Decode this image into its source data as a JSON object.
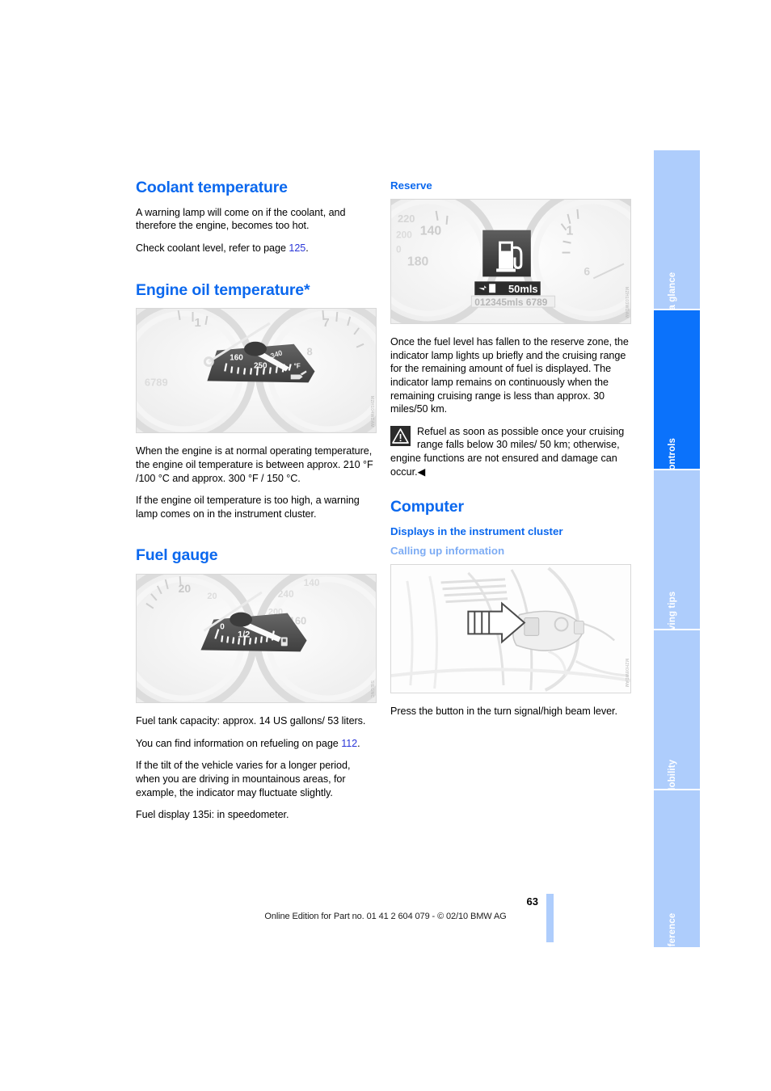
{
  "document": {
    "page_number": "63",
    "footer": "Online Edition for Part no. 01 41 2 604 079 - © 02/10 BMW AG"
  },
  "side_tabs": [
    {
      "label": "At a glance",
      "active": false
    },
    {
      "label": "Controls",
      "active": true
    },
    {
      "label": "Driving tips",
      "active": false
    },
    {
      "label": "Mobility",
      "active": false
    },
    {
      "label": "Reference",
      "active": false
    }
  ],
  "left_column": {
    "coolant": {
      "heading": "Coolant temperature",
      "p1": "A warning lamp will come on if the coolant, and therefore the engine, becomes too hot.",
      "p2_before": "Check coolant level, refer to page ",
      "p2_ref": "125",
      "p2_after": "."
    },
    "oil": {
      "heading": "Engine oil temperature*",
      "figure": {
        "alt": "instrument-cluster-oil-temperature-gauge",
        "code": "MZH104WDAM",
        "gauge_labels": [
          "160",
          "250",
          "340"
        ],
        "unit": "°F",
        "tach_labels": [
          "1",
          "7",
          "8"
        ],
        "odometer": "6789"
      },
      "p1": "When the engine is at normal operating temperature, the engine oil temperature is between approx. 210 °F /100 °C and approx. 300 °F / 150 °C.",
      "p2": "If the engine oil temperature is too high, a warning lamp comes on in the instrument cluster."
    },
    "fuel": {
      "heading": "Fuel gauge",
      "figure": {
        "alt": "instrument-cluster-fuel-gauge",
        "code": "SIEGNC",
        "gauge_labels": [
          "0",
          "1/2"
        ],
        "speedo_labels": [
          "20",
          "240",
          "200",
          "160"
        ]
      },
      "p1": "Fuel tank capacity: approx. 14 US gallons/ 53 liters.",
      "p2_before": "You can find information on refueling on page ",
      "p2_ref": "112",
      "p2_after": ".",
      "p3": "If the tilt of the vehicle varies for a longer period, when you are driving in mountainous areas, for example, the indicator may fluctuate slightly.",
      "p4": "Fuel display 135i: in speedometer."
    }
  },
  "right_column": {
    "reserve": {
      "heading": "Reserve",
      "figure": {
        "alt": "instrument-cluster-fuel-reserve-display",
        "code": "MZH103WDAM",
        "range_value": "50mls",
        "odometer": "012345mls 6789",
        "speedo_labels": [
          "220",
          "200",
          "0",
          "140",
          "180"
        ],
        "tach_labels": [
          "1",
          "6"
        ]
      },
      "p1": "Once the fuel level has fallen to the reserve zone, the indicator lamp lights up briefly and the cruising range for the remaining amount of fuel is displayed. The indicator lamp remains on continuously when the remaining cruising range is less than approx. 30 miles/50 km.",
      "warning": "Refuel as soon as possible once your cruising range falls below 30 miles/ 50 km; otherwise, engine functions are not ensured and damage can occur.",
      "warning_end_marker": "◀"
    },
    "computer": {
      "heading": "Computer",
      "subheading": "Displays in the instrument cluster",
      "subsubheading": "Calling up information",
      "figure": {
        "alt": "turn-signal-high-beam-lever-button",
        "code": "MZH08WDAM"
      },
      "p1": "Press the button in the turn signal/high beam lever."
    }
  },
  "colors": {
    "heading_blue": "#0b68ee",
    "subheading_light_blue": "#7dacf4",
    "tab_active": "#0b72fb",
    "tab_inactive": "#aecdfc",
    "xref_blue": "#2a36d8"
  }
}
